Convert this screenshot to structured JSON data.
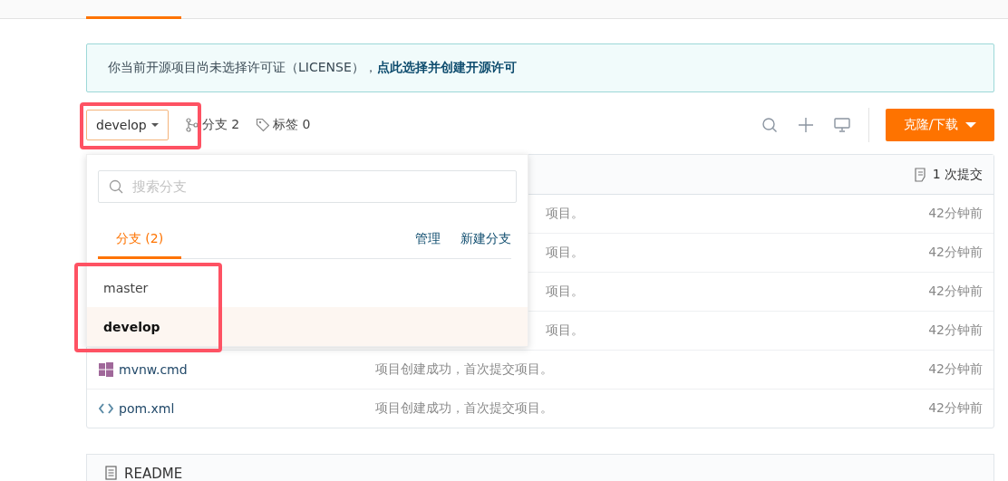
{
  "notice": {
    "text": "你当前开源项目尚未选择许可证（LICENSE），",
    "link": "点此选择并创建开源许可"
  },
  "toolbar": {
    "branch_button": "develop",
    "branches": "分支 2",
    "tags": "标签 0",
    "clone_button": "克隆/下载"
  },
  "files": {
    "commits": "1 次提交",
    "rows": [
      {
        "kind": "covered",
        "message": "项目。",
        "time": "42分钟前"
      },
      {
        "kind": "covered",
        "message": "项目。",
        "time": "42分钟前"
      },
      {
        "kind": "covered",
        "message": "项目。",
        "time": "42分钟前"
      },
      {
        "kind": "covered",
        "message": "项目。",
        "time": "42分钟前"
      },
      {
        "kind": "windows",
        "name": "mvnw.cmd",
        "message": "项目创建成功，首次提交项目。",
        "time": "42分钟前"
      },
      {
        "kind": "code",
        "name": "pom.xml",
        "message": "项目创建成功，首次提交项目。",
        "time": "42分钟前"
      }
    ]
  },
  "dropdown": {
    "search_placeholder": "搜索分支",
    "tab": "分支 (2)",
    "actions": [
      "管理",
      "新建分支"
    ],
    "branches": [
      {
        "name": "master",
        "selected": false
      },
      {
        "name": "develop",
        "selected": true
      }
    ]
  },
  "readme": {
    "title": "README"
  }
}
